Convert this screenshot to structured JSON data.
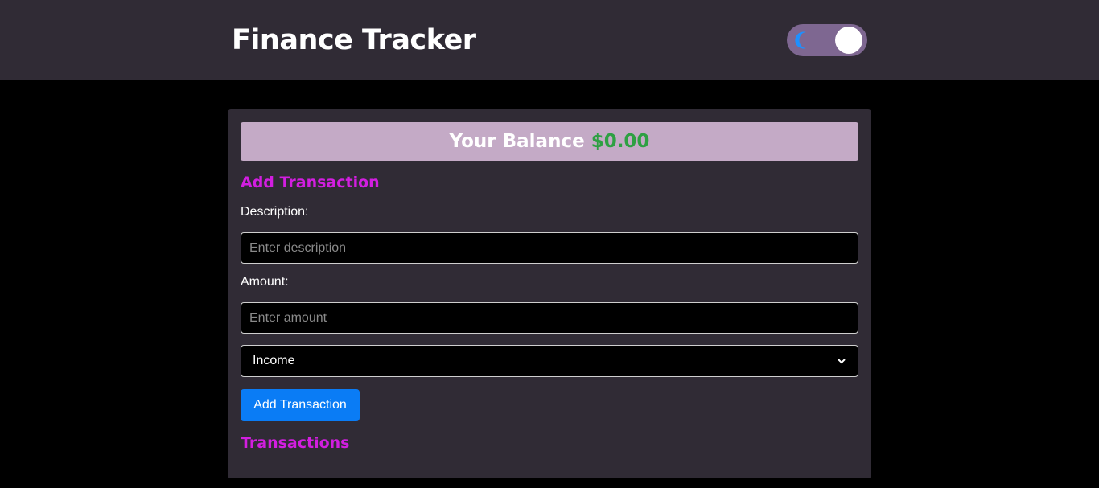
{
  "header": {
    "title": "Finance Tracker",
    "theme_toggle": {
      "state": "dark",
      "icon": "moon-icon"
    }
  },
  "balance": {
    "label": "Your Balance",
    "amount": "$0.00"
  },
  "form": {
    "title": "Add Transaction",
    "description_label": "Description:",
    "description_placeholder": "Enter description",
    "description_value": "",
    "amount_label": "Amount:",
    "amount_placeholder": "Enter amount",
    "amount_value": "",
    "type_selected": "Income",
    "submit_label": "Add Transaction"
  },
  "transactions": {
    "title": "Transactions",
    "items": []
  },
  "colors": {
    "header_bg": "#302b35",
    "page_bg": "#000000",
    "card_bg": "#302b35",
    "balance_bar_bg": "#c4aac6",
    "balance_amount": "#2ea043",
    "section_title": "#d21ee0",
    "button_bg": "#0a7cf5",
    "toggle_bg": "#7e6791",
    "moon": "#1e90ff"
  }
}
